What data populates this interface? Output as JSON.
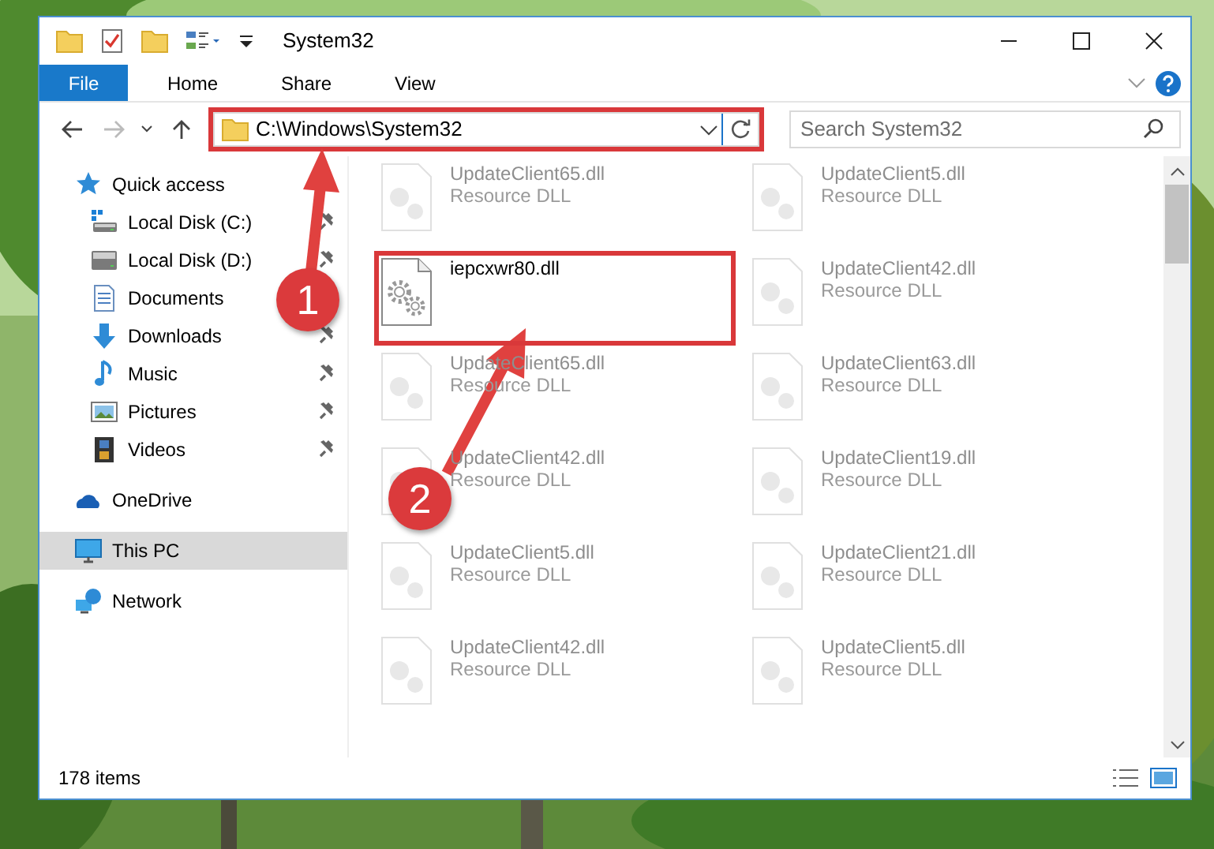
{
  "window": {
    "title": "System32"
  },
  "ribbon": {
    "file_tab": "File",
    "tabs": [
      {
        "label": "Home"
      },
      {
        "label": "Share"
      },
      {
        "label": "View"
      }
    ]
  },
  "address_bar": {
    "path": "C:\\Windows\\System32",
    "highlighted": true,
    "search_placeholder": "Search System32"
  },
  "sidebar": {
    "items": [
      {
        "label": "Quick access",
        "kind": "star",
        "selected": false,
        "children": [
          {
            "label": "Local Disk (C:)",
            "kind": "system-drive",
            "pinned": true,
            "selected": false
          },
          {
            "label": "Local Disk (D:)",
            "kind": "drive",
            "pinned": true,
            "selected": false
          },
          {
            "label": "Documents",
            "kind": "documents",
            "selected": false
          },
          {
            "label": "Downloads",
            "kind": "downloads",
            "pinned": true,
            "selected": false
          },
          {
            "label": "Music",
            "kind": "music",
            "pinned": true,
            "selected": false
          },
          {
            "label": "Pictures",
            "kind": "pictures",
            "pinned": true,
            "selected": false
          },
          {
            "label": "Videos",
            "kind": "videos",
            "pinned": true,
            "selected": false
          }
        ]
      },
      {
        "label": "OneDrive",
        "kind": "cloud",
        "selected": false
      },
      {
        "label": "This PC",
        "kind": "computer",
        "selected": true
      },
      {
        "label": "Network",
        "kind": "network",
        "selected": false
      }
    ]
  },
  "files": [
    {
      "name": "UpdateClient65.dll",
      "type": "Resource DLL",
      "faded": true,
      "highlighted": false
    },
    {
      "name": "UpdateClient5.dll",
      "type": "Resource DLL",
      "faded": true,
      "highlighted": false
    },
    {
      "name": "iepcxwr80.dll",
      "faded": false,
      "highlighted": true
    },
    {
      "name": "UpdateClient42.dll",
      "type": "Resource DLL",
      "faded": true,
      "highlighted": false
    },
    {
      "name": "UpdateClient65.dll",
      "type": "Resource DLL",
      "faded": true,
      "highlighted": false
    },
    {
      "name": "UpdateClient63.dll",
      "type": "Resource DLL",
      "faded": true,
      "highlighted": false
    },
    {
      "name": "UpdateClient42.dll",
      "type": "Resource DLL",
      "faded": true,
      "highlighted": false
    },
    {
      "name": "UpdateClient19.dll",
      "type": "Resource DLL",
      "faded": true,
      "highlighted": false
    },
    {
      "name": "UpdateClient5.dll",
      "type": "Resource DLL",
      "faded": true,
      "highlighted": false
    },
    {
      "name": "UpdateClient21.dll",
      "type": "Resource DLL",
      "faded": true,
      "highlighted": false
    },
    {
      "name": "UpdateClient42.dll",
      "type": "Resource DLL",
      "faded": true,
      "highlighted": false
    },
    {
      "name": "UpdateClient5.dll",
      "type": "Resource DLL",
      "faded": true,
      "highlighted": false
    }
  ],
  "status_bar": {
    "item_count": "178 items"
  },
  "annotations": [
    {
      "label": "1"
    },
    {
      "label": "2"
    }
  ]
}
